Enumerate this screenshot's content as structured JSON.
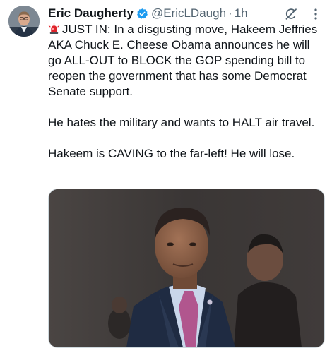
{
  "author": {
    "name": "Eric Daugherty",
    "handle": "@EricLDaugh",
    "separator": "·",
    "time": "1h"
  },
  "post": {
    "emoji": "siren-emoji",
    "paragraphs": [
      "JUST IN: In a disgusting move, Hakeem Jeffries AKA Chuck E. Cheese Obama announces he will go ALL-OUT to BLOCK the GOP spending bill to reopen the government that has some Democrat Senate support.",
      "He hates the military and wants to HALT air travel.",
      "Hakeem is CAVING to the far-left! He will lose."
    ]
  },
  "icons": {
    "verified": "verified-badge-icon",
    "grok": "grok-icon",
    "more": "more-options-icon"
  },
  "colors": {
    "verified": "#1d9bf0",
    "secondary_text": "#536471",
    "siren": "#e0242b"
  }
}
